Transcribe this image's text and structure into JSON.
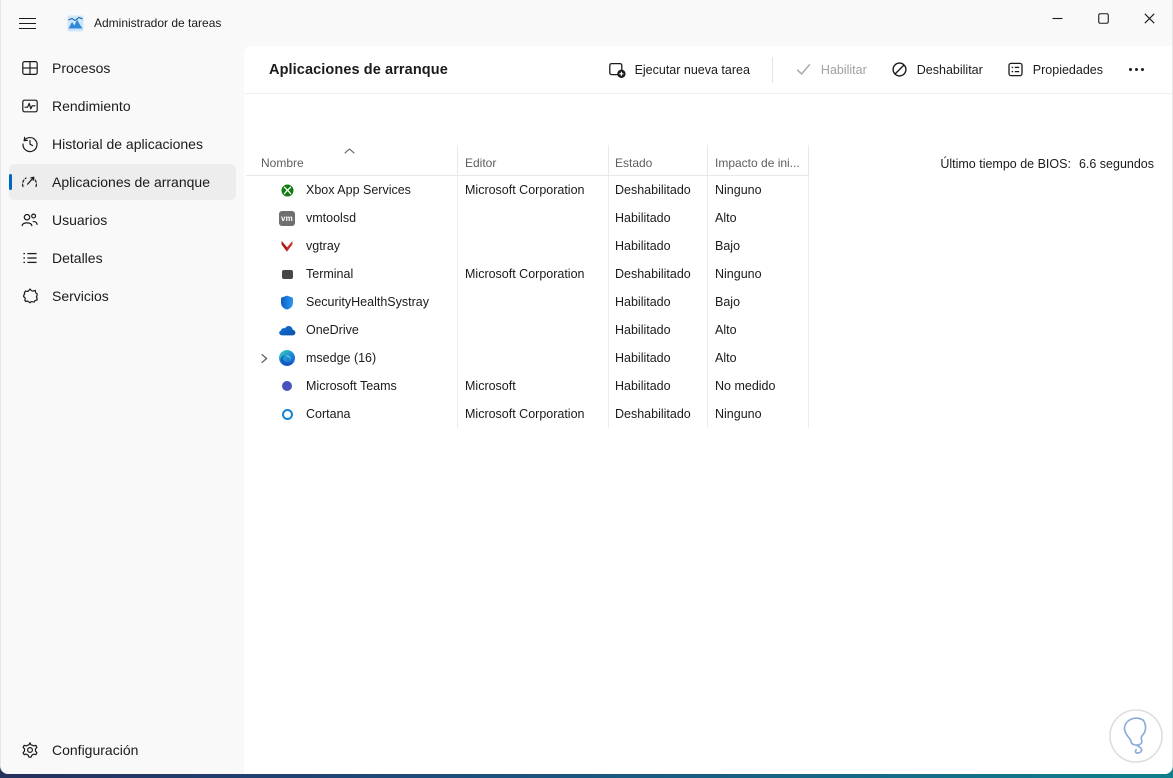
{
  "colors": {
    "accent": "#0067c0",
    "sidebar_bg": "#f9f9f9",
    "content_bg": "#ffffff"
  },
  "titlebar": {
    "title": "Administrador de tareas",
    "controls": [
      {
        "name": "minimize-button",
        "icon": "minimize-icon"
      },
      {
        "name": "maximize-button",
        "icon": "maximize-icon"
      },
      {
        "name": "close-button",
        "icon": "close-icon"
      }
    ]
  },
  "sidebar": {
    "items": [
      {
        "label": "Procesos",
        "icon": "processes-icon",
        "selected": false
      },
      {
        "label": "Rendimiento",
        "icon": "performance-icon",
        "selected": false
      },
      {
        "label": "Historial de aplicaciones",
        "icon": "app-history-icon",
        "selected": false
      },
      {
        "label": "Aplicaciones de arranque",
        "icon": "startup-apps-icon",
        "selected": true
      },
      {
        "label": "Usuarios",
        "icon": "users-icon",
        "selected": false
      },
      {
        "label": "Detalles",
        "icon": "details-icon",
        "selected": false
      },
      {
        "label": "Servicios",
        "icon": "services-icon",
        "selected": false
      }
    ],
    "footer": {
      "label": "Configuración",
      "icon": "settings-icon"
    }
  },
  "toolbar": {
    "title": "Aplicaciones de arranque",
    "actions": [
      {
        "label": "Ejecutar nueva tarea",
        "icon": "new-task-icon",
        "enabled": true
      },
      {
        "label": "Habilitar",
        "icon": "check-icon",
        "enabled": false
      },
      {
        "label": "Deshabilitar",
        "icon": "disable-icon",
        "enabled": true
      },
      {
        "label": "Propiedades",
        "icon": "properties-icon",
        "enabled": true
      }
    ],
    "more_icon": "more-icon"
  },
  "status": {
    "bios_label": "Último tiempo de BIOS:",
    "bios_value": "6.6 segundos"
  },
  "table": {
    "columns": [
      {
        "label": "Nombre",
        "sorted": "asc"
      },
      {
        "label": "Editor",
        "sorted": null
      },
      {
        "label": "Estado",
        "sorted": null
      },
      {
        "label": "Impacto de ini...",
        "sorted": null
      }
    ],
    "rows": [
      {
        "name": "Xbox App Services",
        "publisher": "Microsoft Corporation",
        "status": "Deshabilitado",
        "impact": "Ninguno",
        "icon": "xbox-icon",
        "expandable": false
      },
      {
        "name": "vmtoolsd",
        "publisher": "",
        "status": "Habilitado",
        "impact": "Alto",
        "icon": "vmware-icon",
        "expandable": false
      },
      {
        "name": "vgtray",
        "publisher": "",
        "status": "Habilitado",
        "impact": "Bajo",
        "icon": "vgtray-icon",
        "expandable": false
      },
      {
        "name": "Terminal",
        "publisher": "Microsoft Corporation",
        "status": "Deshabilitado",
        "impact": "Ninguno",
        "icon": "terminal-icon",
        "expandable": false
      },
      {
        "name": "SecurityHealthSystray",
        "publisher": "",
        "status": "Habilitado",
        "impact": "Bajo",
        "icon": "shield-icon",
        "expandable": false
      },
      {
        "name": "OneDrive",
        "publisher": "",
        "status": "Habilitado",
        "impact": "Alto",
        "icon": "onedrive-icon",
        "expandable": false
      },
      {
        "name": "msedge (16)",
        "publisher": "",
        "status": "Habilitado",
        "impact": "Alto",
        "icon": "edge-icon",
        "expandable": true
      },
      {
        "name": "Microsoft Teams",
        "publisher": "Microsoft",
        "status": "Habilitado",
        "impact": "No medido",
        "icon": "teams-icon",
        "expandable": false
      },
      {
        "name": "Cortana",
        "publisher": "Microsoft Corporation",
        "status": "Deshabilitado",
        "impact": "Ninguno",
        "icon": "cortana-icon",
        "expandable": false
      }
    ]
  }
}
